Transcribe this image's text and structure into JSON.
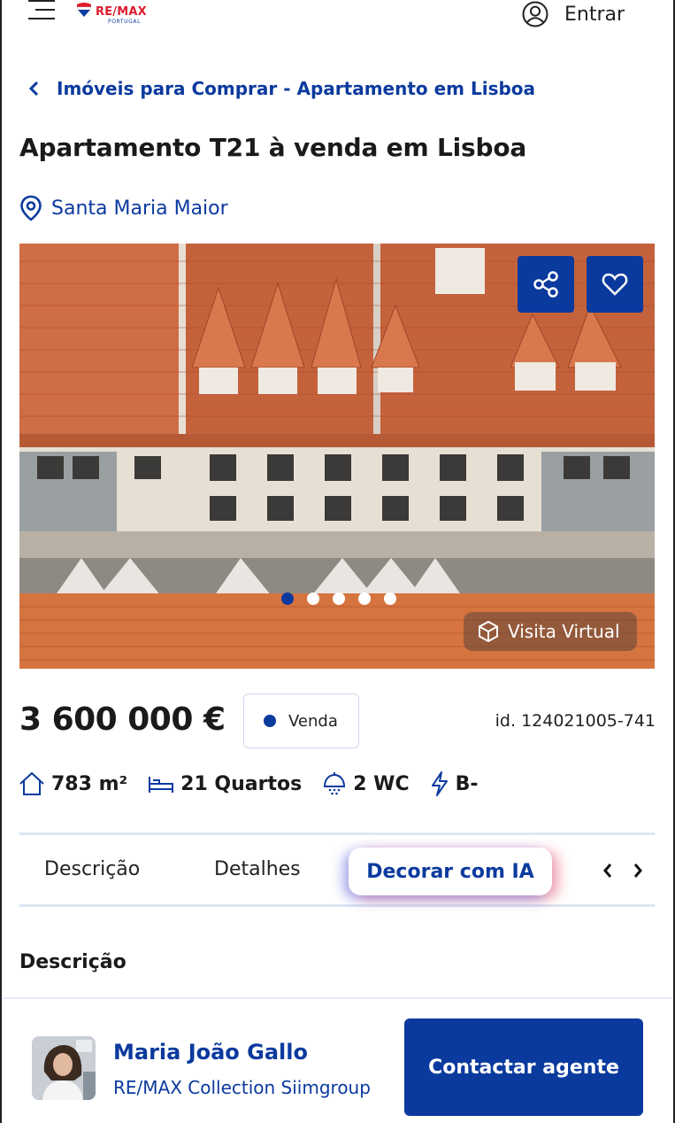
{
  "header": {
    "logo_text": "RE/MAX",
    "logo_sub": "PORTUGAL",
    "login_label": "Entrar"
  },
  "breadcrumb": {
    "label": "Imóveis para Comprar - Apartamento em Lisboa"
  },
  "listing": {
    "title": "Apartamento T21 à venda em Lisboa",
    "location": "Santa Maria Maior",
    "gallery": {
      "slide_count": 5,
      "active_slide": 1,
      "virtual_tour_label": "Visita Virtual"
    },
    "price": "3 600 000 €",
    "deal_type": "Venda",
    "reference": "id. 124021005-741",
    "features": {
      "area": "783 m²",
      "bedrooms": "21 Quartos",
      "bathrooms": "2 WC",
      "energy": "B-"
    }
  },
  "tabs": [
    {
      "label": "Descrição"
    },
    {
      "label": "Detalhes"
    },
    {
      "label": "Decorar com IA"
    }
  ],
  "section": {
    "title": "Descrição"
  },
  "agent": {
    "name": "Maria João Gallo",
    "office": "RE/MAX Collection Siimgroup",
    "contact_label": "Contactar agente"
  },
  "colors": {
    "brand_blue": "#0b3a9e",
    "brand_red": "#dc1c2e"
  }
}
